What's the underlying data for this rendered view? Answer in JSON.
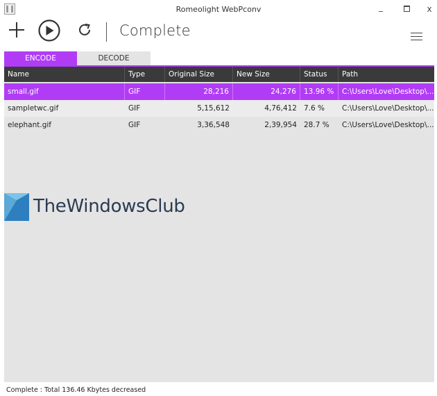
{
  "window": {
    "title": "Romeolight WebPconv",
    "min_glyph": "_",
    "close_glyph": "x"
  },
  "toolbar": {
    "status_text": "Complete"
  },
  "tabs": [
    {
      "label": "ENCODE",
      "active": true
    },
    {
      "label": "DECODE",
      "active": false
    }
  ],
  "table": {
    "columns": [
      "Name",
      "Type",
      "Original Size",
      "New Size",
      "Status",
      "Path"
    ],
    "rows": [
      {
        "name": "small.gif",
        "type": "GIF",
        "original_size": "28,216",
        "new_size": "24,276",
        "status": "13.96 %",
        "path": "C:\\Users\\Love\\Desktop\\...",
        "selected": true
      },
      {
        "name": "sampletwc.gif",
        "type": "GIF",
        "original_size": "5,15,612",
        "new_size": "4,76,412",
        "status": "7.6 %",
        "path": "C:\\Users\\Love\\Desktop\\...",
        "selected": false
      },
      {
        "name": "elephant.gif",
        "type": "GIF",
        "original_size": "3,36,548",
        "new_size": "2,39,954",
        "status": "28.7 %",
        "path": "C:\\Users\\Love\\Desktop\\...",
        "selected": false
      }
    ]
  },
  "watermark": {
    "text": "TheWindowsClub"
  },
  "statusbar": {
    "text": "Complete : Total 136.46 Kbytes decreased"
  },
  "colors": {
    "accent": "#b13cf6",
    "header_bg": "#3a3a3a",
    "table_bg": "#e4e4e4"
  },
  "icons": {
    "app": "app-logo-icon",
    "add": "plus-icon",
    "start": "play-circle-icon",
    "refresh": "refresh-icon",
    "menu": "hamburger-menu-icon"
  }
}
